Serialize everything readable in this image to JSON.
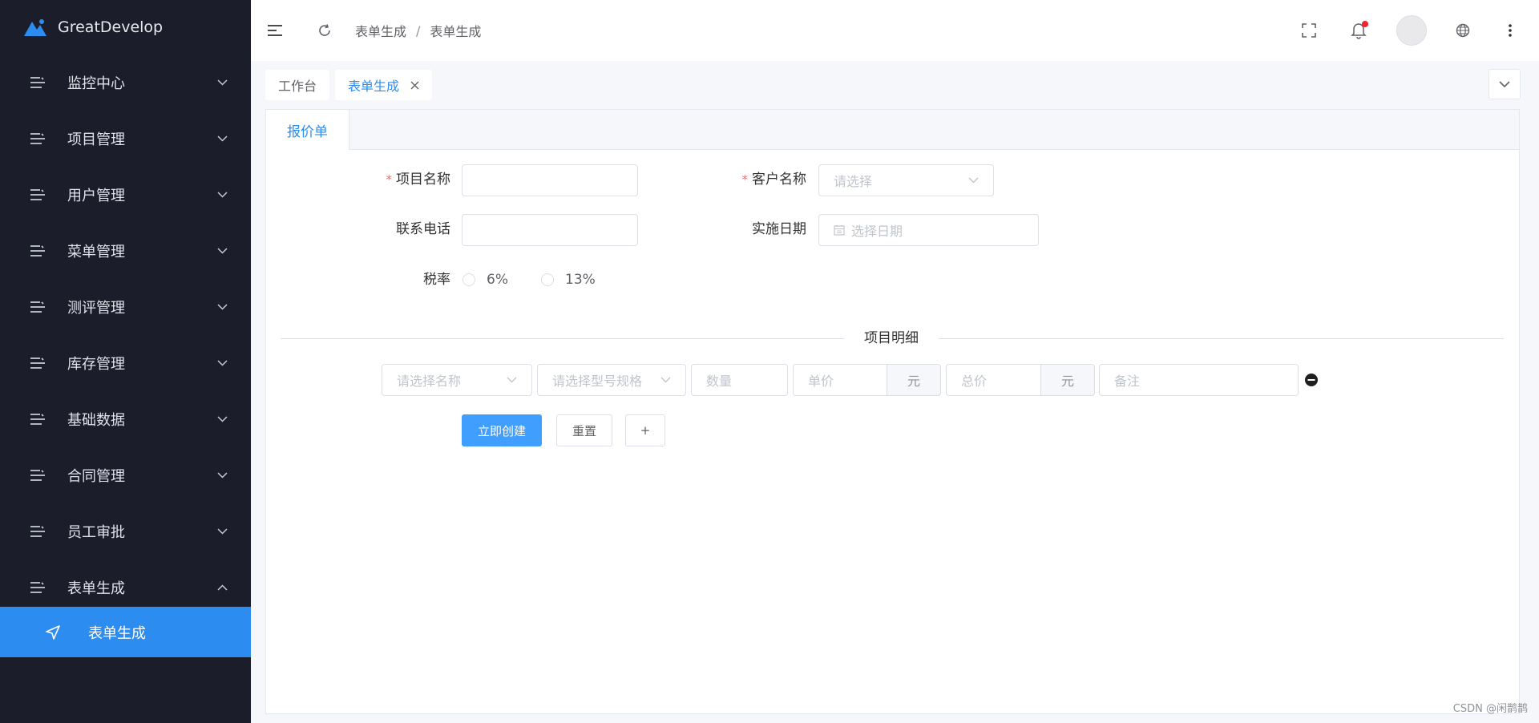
{
  "app": {
    "name": "GreatDevelop"
  },
  "sidebar": {
    "items": [
      {
        "label": "监控中心",
        "expanded": false
      },
      {
        "label": "项目管理",
        "expanded": false
      },
      {
        "label": "用户管理",
        "expanded": false
      },
      {
        "label": "菜单管理",
        "expanded": false
      },
      {
        "label": "测评管理",
        "expanded": false
      },
      {
        "label": "库存管理",
        "expanded": false
      },
      {
        "label": "基础数据",
        "expanded": false
      },
      {
        "label": "合同管理",
        "expanded": false
      },
      {
        "label": "员工审批",
        "expanded": false
      },
      {
        "label": "表单生成",
        "expanded": true
      }
    ],
    "active_subitem": {
      "label": "表单生成",
      "icon": "navigation-icon"
    }
  },
  "header": {
    "breadcrumb": [
      "表单生成",
      "表单生成"
    ],
    "breadcrumb_separator": "/",
    "icons": [
      "hamburger-icon",
      "refresh-icon",
      "fullscreen-icon",
      "bell-icon",
      "avatar",
      "globe-icon",
      "more-icon"
    ],
    "notification_dot_color": "#f5222d"
  },
  "tabs": [
    {
      "label": "工作台",
      "active": false
    },
    {
      "label": "表单生成",
      "active": true,
      "closable": true
    }
  ],
  "card": {
    "tab": "报价单",
    "form": {
      "project_name": {
        "label": "项目名称",
        "required": true,
        "value": ""
      },
      "customer_name": {
        "label": "客户名称",
        "required": true,
        "placeholder": "请选择"
      },
      "phone": {
        "label": "联系电话",
        "value": ""
      },
      "date": {
        "label": "实施日期",
        "placeholder": "选择日期"
      },
      "tax": {
        "label": "税率",
        "options": [
          "6%",
          "13%"
        ],
        "selected": null
      }
    },
    "divider": "项目明细",
    "detail_row": {
      "name_placeholder": "请选择名称",
      "model_placeholder": "请选择型号规格",
      "qty_placeholder": "数量",
      "price_placeholder": "单价",
      "price_unit": "元",
      "total_placeholder": "总价",
      "total_unit": "元",
      "remark_placeholder": "备注"
    },
    "buttons": {
      "submit": "立即创建",
      "reset": "重置",
      "add": "+"
    }
  },
  "watermark": "CSDN @闲鹊鹊",
  "colors": {
    "sidebar_bg": "#1c1d2b",
    "accent": "#2d8cf0",
    "primary_button": "#409eff",
    "required": "#f56c6c"
  }
}
